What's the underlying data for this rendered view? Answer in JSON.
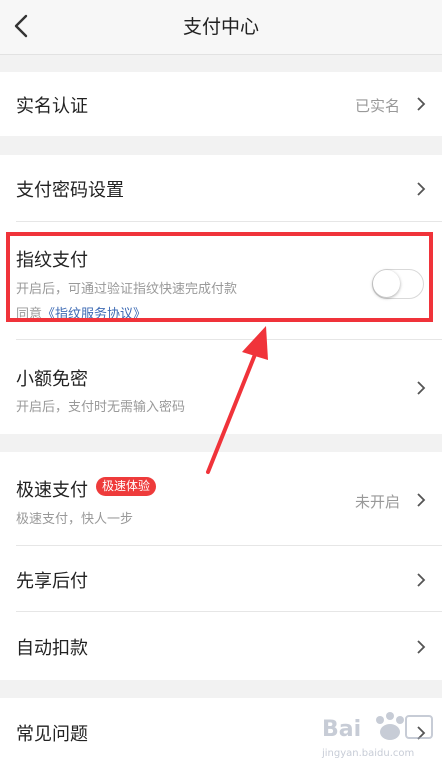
{
  "header": {
    "title": "支付中心"
  },
  "rows": {
    "realname": {
      "title": "实名认证",
      "value": "已实名"
    },
    "paypwd": {
      "title": "支付密码设置"
    },
    "fingerprint": {
      "title": "指纹支付",
      "subtitle": "开启后，可通过验证指纹快速完成付款",
      "agree_prefix": "同意",
      "agree_link": "《指纹服务协议》",
      "enabled": false
    },
    "smallfree": {
      "title": "小额免密",
      "subtitle": "开启后，支付时无需输入密码"
    },
    "fastpay": {
      "title": "极速支付",
      "badge": "极速体验",
      "subtitle": "极速支付，快人一步",
      "value": "未开启"
    },
    "paylater": {
      "title": "先享后付"
    },
    "autodebit": {
      "title": "自动扣款"
    },
    "faq": {
      "title": "常见问题"
    }
  },
  "colors": {
    "highlight": "#f0333a",
    "badge": "#ee3b3b",
    "link": "#3e6bb4"
  },
  "watermark": {
    "brand": "Bai",
    "domain": "jingyan.baidu.com"
  }
}
